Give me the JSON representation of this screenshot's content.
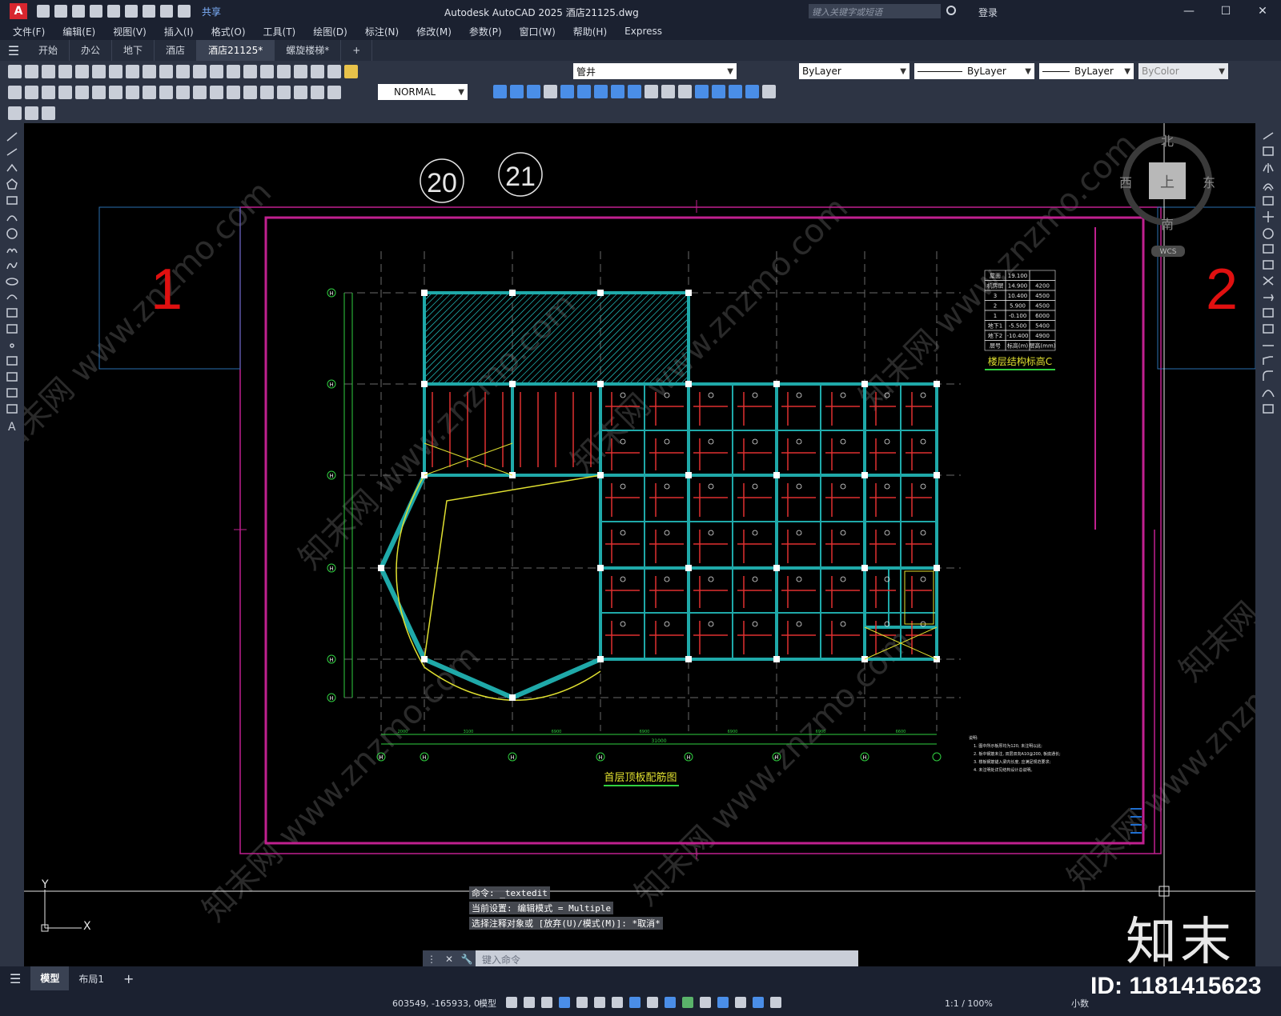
{
  "titlebar": {
    "app_icon": "A",
    "share_label": "共享",
    "title": "Autodesk AutoCAD 2025    酒店21125.dwg",
    "search_placeholder": "键入关键字或短语",
    "login_label": "登录",
    "minimize": "—",
    "maximize": "☐",
    "close": "✕"
  },
  "menu": [
    "文件(F)",
    "编辑(E)",
    "视图(V)",
    "插入(I)",
    "格式(O)",
    "工具(T)",
    "绘图(D)",
    "标注(N)",
    "修改(M)",
    "参数(P)",
    "窗口(W)",
    "帮助(H)",
    "Express"
  ],
  "tabs": [
    {
      "label": "开始",
      "active": false
    },
    {
      "label": "办公",
      "active": false
    },
    {
      "label": "地下",
      "active": false
    },
    {
      "label": "酒店",
      "active": false
    },
    {
      "label": "酒店21125*",
      "active": true
    },
    {
      "label": "螺旋楼梯*",
      "active": false
    }
  ],
  "toolbar": {
    "layer_value": "管井",
    "color_value": "ByLayer",
    "linetype_value": "ByLayer",
    "lineweight_value": "ByLayer",
    "plotstyle_value": "ByColor",
    "dimstyle_value": "NORMAL"
  },
  "drawing": {
    "circle_labels": [
      "20",
      "21"
    ],
    "sheet_number_left": "1",
    "sheet_number_right": "2",
    "table_rows": [
      [
        "屋面",
        "19.100",
        ""
      ],
      [
        "机房层",
        "14.900",
        "4200"
      ],
      [
        "3",
        "10.400",
        "4500"
      ],
      [
        "2",
        "5.900",
        "4500"
      ],
      [
        "1",
        "-0.100",
        "6000"
      ],
      [
        "地下1",
        "-5.500",
        "5400"
      ],
      [
        "地下2",
        "-10.400",
        "4900"
      ],
      [
        "层号",
        "标高(m)",
        "层高(mm)"
      ]
    ],
    "table_title": "楼层结构标高C",
    "plan_title": "首层顶板配筋图",
    "dim_total": "31000",
    "dims_bottom": [
      "2000",
      "3100",
      "6900",
      "6900",
      "6900",
      "6900",
      "6600"
    ],
    "notes": [
      "说明:",
      "1. 图中所示板厚均为120, 未注明以此;",
      "2. 板中钢筋未注, 双层双向A10@200, 板底通长;",
      "3. 楼板钢筋锚入梁内长度, 应满足规范要求;",
      "4. 未注明处详见结构设计总说明。"
    ],
    "grid_left": [
      "H",
      "H",
      "H",
      "H",
      "H",
      "H"
    ],
    "grid_bottom": [
      "H",
      "H",
      "H",
      "H",
      "H",
      "H",
      "H"
    ]
  },
  "viewcube": {
    "north": "北",
    "south": "南",
    "east": "东",
    "west": "西",
    "top": "上",
    "wcs": "WCS"
  },
  "ucs": {
    "x": "X",
    "y": "Y"
  },
  "command": {
    "history": [
      "命令: _textedit",
      "当前设置: 编辑模式 = Multiple",
      "选择注释对象或 [放弃(U)/模式(M)]: *取消*"
    ],
    "placeholder": "键入命令"
  },
  "bottom_tabs": [
    {
      "label": "模型",
      "active": true
    },
    {
      "label": "布局1",
      "active": false
    }
  ],
  "status": {
    "coords": "603549, -165933, 0",
    "model": "模型",
    "scale": "1:1 / 100%",
    "units": "小数"
  },
  "watermark": {
    "brand": "知末",
    "id": "ID: 1181415623",
    "site": "知末网 www.znzmo.com"
  },
  "colors": {
    "canvas": "#000000",
    "frame": "#c0208f",
    "structure": "#1fa9a9",
    "rebar": "#e03030",
    "grid_axis": "#30d040",
    "annotation": "#e0e030"
  }
}
